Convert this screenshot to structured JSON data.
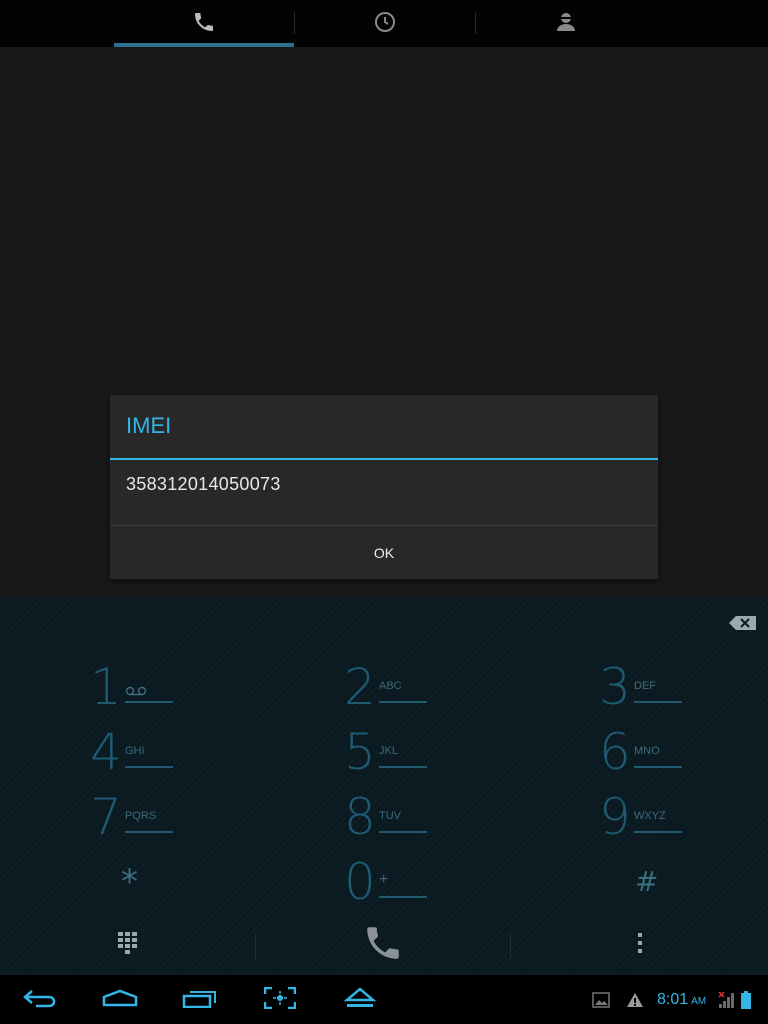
{
  "tabs": [
    {
      "icon": "phone-icon",
      "active": true
    },
    {
      "icon": "clock-icon",
      "active": false
    },
    {
      "icon": "contact-icon",
      "active": false
    }
  ],
  "dialog": {
    "title": "IMEI",
    "message": "358312014050073",
    "ok_label": "OK"
  },
  "dialpad": {
    "keys": [
      {
        "digit": "1",
        "letters": "",
        "icon": "voicemail-icon"
      },
      {
        "digit": "2",
        "letters": "ABC"
      },
      {
        "digit": "3",
        "letters": "DEF"
      },
      {
        "digit": "4",
        "letters": "GHI"
      },
      {
        "digit": "5",
        "letters": "JKL"
      },
      {
        "digit": "6",
        "letters": "MNO"
      },
      {
        "digit": "7",
        "letters": "PQRS"
      },
      {
        "digit": "8",
        "letters": "TUV"
      },
      {
        "digit": "9",
        "letters": "WXYZ"
      },
      {
        "digit": "*",
        "letters": ""
      },
      {
        "digit": "0",
        "letters": "+"
      },
      {
        "digit": "#",
        "letters": ""
      }
    ],
    "actions": [
      "dialpad-toggle-icon",
      "call-icon",
      "overflow-menu-icon"
    ],
    "backspace_icon": "backspace-icon"
  },
  "status_bar": {
    "time": "8:01",
    "ampm": "AM",
    "icons": [
      "gallery-icon",
      "warning-icon",
      "signal-icon",
      "battery-icon"
    ]
  },
  "nav_bar": [
    "back-icon",
    "home-icon",
    "recent-apps-icon",
    "screenshot-icon",
    "eject-icon"
  ],
  "colors": {
    "accent": "#33b5e5",
    "dialpad_digit": "#1e5a72",
    "background": "#161616"
  }
}
